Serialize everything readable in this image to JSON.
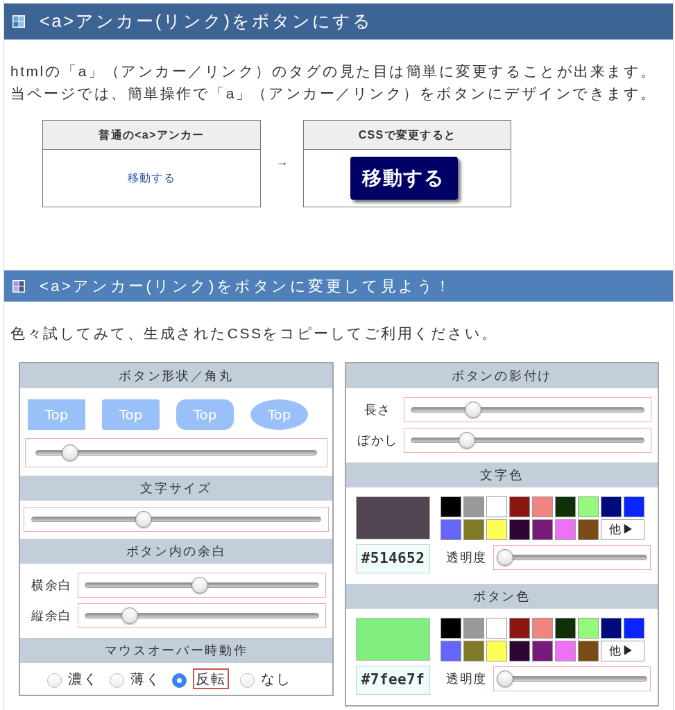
{
  "header_1": {
    "title": "<a>アンカー(リンク)をボタンにする"
  },
  "intro": {
    "lines": [
      "htmlの「a」（アンカー／リンク）のタグの見た目は簡単に変更することが出来ます。",
      "当ページでは、簡単操作で「a」（アンカー／リンク）をボタンにデザインできます。"
    ]
  },
  "comparison": {
    "before": {
      "heading": "普通の<a>アンカー",
      "link": "移動する"
    },
    "arrow": "→",
    "after": {
      "heading": "CSSで変更すると",
      "button": "移動する"
    }
  },
  "header_2": {
    "title": "<a>アンカー(リンク)をボタンに変更して見よう！"
  },
  "instructions": "色々試してみて、生成されたCSSをコピーしてご利用ください。",
  "left_panel": [
    {
      "kind": "shapes",
      "heading": "ボタン形状／角丸",
      "samples": [
        {
          "label": "Top",
          "kind": "square"
        },
        {
          "label": "Top",
          "kind": "rounded"
        },
        {
          "label": "Top",
          "kind": "pill"
        },
        {
          "label": "Top",
          "kind": "ellipse"
        }
      ],
      "slider": {
        "level": 0.1
      }
    },
    {
      "kind": "slider",
      "heading": "文字サイズ",
      "slider": {
        "level": 0.38
      }
    },
    {
      "kind": "labeled_sliders",
      "heading": "ボタン内の余白",
      "rows": [
        {
          "label": "横余白",
          "level": 0.49
        },
        {
          "label": "縦余白",
          "level": 0.17
        }
      ]
    },
    {
      "kind": "radios",
      "heading": "マウスオーバー時動作",
      "options": [
        {
          "label": "濃く",
          "selected": false
        },
        {
          "label": "薄く",
          "selected": false
        },
        {
          "label": "反転",
          "selected": true
        },
        {
          "label": "なし",
          "selected": false
        }
      ]
    }
  ],
  "right_panel": [
    {
      "kind": "labeled_sliders",
      "heading": "ボタンの影付け",
      "rows": [
        {
          "label": "長さ",
          "level": 0.25
        },
        {
          "label": "ぼかし",
          "level": 0.22
        }
      ]
    },
    {
      "kind": "color",
      "heading": "文字色",
      "value": "#514652",
      "swatches": [
        {
          "color": "#000000"
        },
        {
          "color": "#999999"
        },
        {
          "color": "#ffffff"
        },
        {
          "color": "#8b1710"
        },
        {
          "color": "#ef8480"
        },
        {
          "color": "#103008"
        },
        {
          "color": "#95fa7b"
        },
        {
          "color": "#000b7b"
        },
        {
          "color": "#0b24fb"
        },
        {
          "color": "#6565f7"
        },
        {
          "color": "#7f7a28"
        },
        {
          "color": "#fffe54"
        },
        {
          "color": "#2e0533"
        },
        {
          "color": "#771a78"
        },
        {
          "color": "#ee72f5"
        },
        {
          "color": "#7a4a17"
        }
      ],
      "more_button": "他▶",
      "opacity": {
        "label": "透明度",
        "level": 0
      }
    },
    {
      "kind": "color",
      "heading": "ボタン色",
      "value": "#7fee7f",
      "swatches": [
        {
          "color": "#000000"
        },
        {
          "color": "#999999"
        },
        {
          "color": "#ffffff"
        },
        {
          "color": "#8b1710"
        },
        {
          "color": "#ef8480"
        },
        {
          "color": "#103008"
        },
        {
          "color": "#95fa7b"
        },
        {
          "color": "#000b7b"
        },
        {
          "color": "#0b24fb"
        },
        {
          "color": "#6565f7"
        },
        {
          "color": "#7f7a28"
        },
        {
          "color": "#fffe54"
        },
        {
          "color": "#2e0533"
        },
        {
          "color": "#771a78"
        },
        {
          "color": "#ee72f5"
        },
        {
          "color": "#7a4a17"
        }
      ],
      "more_button": "他▶",
      "opacity": {
        "label": "透明度",
        "level": 0
      }
    }
  ]
}
